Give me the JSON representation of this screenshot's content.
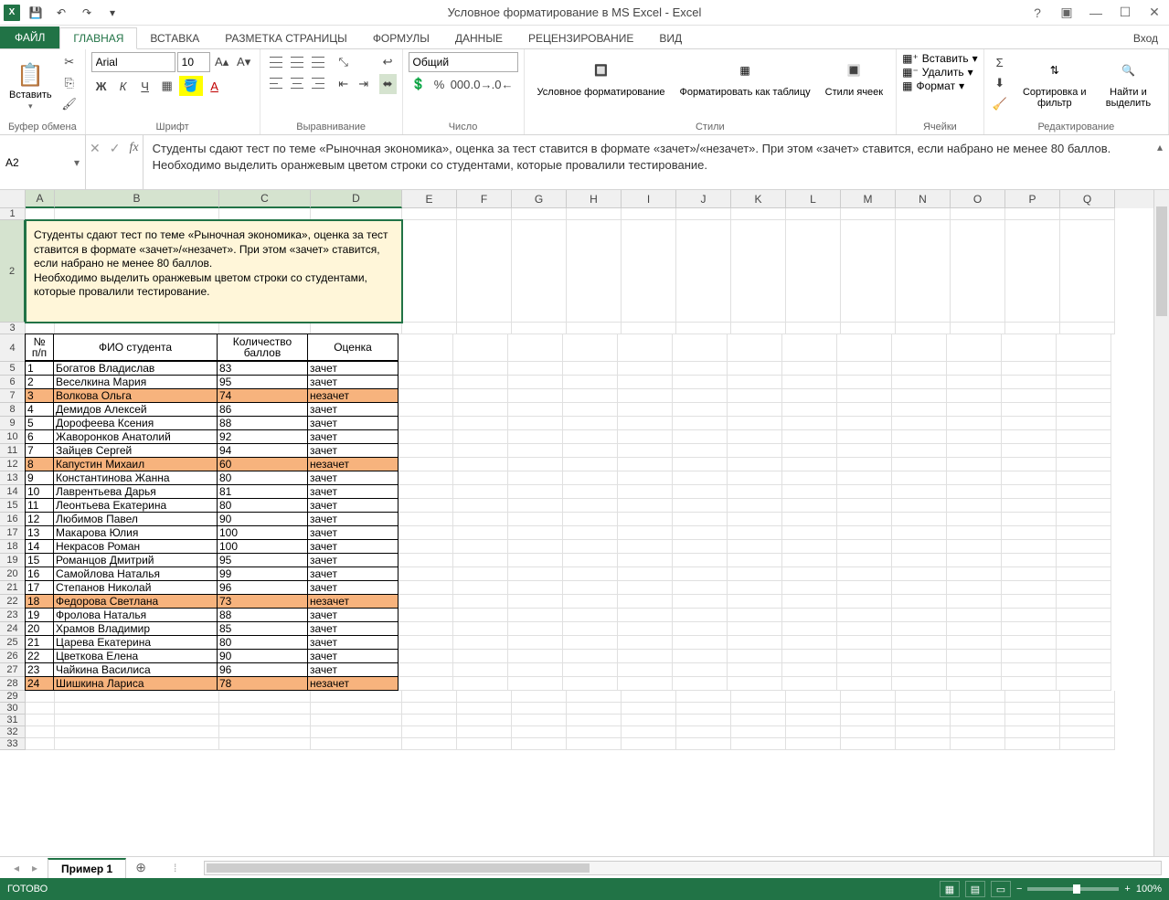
{
  "title": "Условное форматирование в MS Excel - Excel",
  "signin": "Вход",
  "tabs": [
    "ФАЙЛ",
    "ГЛАВНАЯ",
    "ВСТАВКА",
    "РАЗМЕТКА СТРАНИЦЫ",
    "ФОРМУЛЫ",
    "ДАННЫЕ",
    "РЕЦЕНЗИРОВАНИЕ",
    "ВИД"
  ],
  "ribbon": {
    "clipboard": {
      "label": "Буфер обмена",
      "paste": "Вставить"
    },
    "font": {
      "label": "Шрифт",
      "name": "Arial",
      "size": "10"
    },
    "alignment": {
      "label": "Выравнивание"
    },
    "number": {
      "label": "Число",
      "format": "Общий"
    },
    "styles": {
      "label": "Стили",
      "cond": "Условное форматирование",
      "table": "Форматировать как таблицу",
      "cell": "Стили ячеек"
    },
    "cells": {
      "label": "Ячейки",
      "insert": "Вставить",
      "delete": "Удалить",
      "format": "Формат"
    },
    "editing": {
      "label": "Редактирование",
      "sort": "Сортировка и фильтр",
      "find": "Найти и выделить"
    }
  },
  "namebox": "A2",
  "formula_line1": "Студенты сдают тест по теме «Рыночная экономика», оценка за тест ставится в формате «зачет»/«незачет». При этом «зачет» ставится, если набрано не менее 80 баллов.",
  "formula_line2": "Необходимо выделить оранжевым цветом строки со студентами, которые провалили тестирование.",
  "yellow_text": "Студенты сдают тест по теме «Рыночная экономика», оценка за тест ставится в формате «зачет»/«незачет». При этом «зачет» ставится, если набрано не менее 80 баллов.\nНеобходимо выделить оранжевым цветом строки со студентами, которые провалили тестирование.",
  "col_headers": [
    "A",
    "B",
    "C",
    "D",
    "E",
    "F",
    "G",
    "H",
    "I",
    "J",
    "K",
    "L",
    "M",
    "N",
    "O",
    "P",
    "Q"
  ],
  "table_headers": {
    "num": "№ п/п",
    "fio": "ФИО студента",
    "score": "Количество баллов",
    "grade": "Оценка"
  },
  "rows": [
    {
      "n": "1",
      "fio": "Богатов Владислав",
      "s": "83",
      "g": "зачет",
      "hl": false
    },
    {
      "n": "2",
      "fio": "Веселкина Мария",
      "s": "95",
      "g": "зачет",
      "hl": false
    },
    {
      "n": "3",
      "fio": "Волкова Ольга",
      "s": "74",
      "g": "незачет",
      "hl": true
    },
    {
      "n": "4",
      "fio": "Демидов Алексей",
      "s": "86",
      "g": "зачет",
      "hl": false
    },
    {
      "n": "5",
      "fio": "Дорофеева Ксения",
      "s": "88",
      "g": "зачет",
      "hl": false
    },
    {
      "n": "6",
      "fio": "Жаворонков Анатолий",
      "s": "92",
      "g": "зачет",
      "hl": false
    },
    {
      "n": "7",
      "fio": "Зайцев Сергей",
      "s": "94",
      "g": "зачет",
      "hl": false
    },
    {
      "n": "8",
      "fio": "Капустин Михаил",
      "s": "60",
      "g": "незачет",
      "hl": true
    },
    {
      "n": "9",
      "fio": "Константинова Жанна",
      "s": "80",
      "g": "зачет",
      "hl": false
    },
    {
      "n": "10",
      "fio": "Лаврентьева Дарья",
      "s": "81",
      "g": "зачет",
      "hl": false
    },
    {
      "n": "11",
      "fio": "Леонтьева Екатерина",
      "s": "80",
      "g": "зачет",
      "hl": false
    },
    {
      "n": "12",
      "fio": "Любимов Павел",
      "s": "90",
      "g": "зачет",
      "hl": false
    },
    {
      "n": "13",
      "fio": "Макарова Юлия",
      "s": "100",
      "g": "зачет",
      "hl": false
    },
    {
      "n": "14",
      "fio": "Некрасов Роман",
      "s": "100",
      "g": "зачет",
      "hl": false
    },
    {
      "n": "15",
      "fio": "Романцов Дмитрий",
      "s": "95",
      "g": "зачет",
      "hl": false
    },
    {
      "n": "16",
      "fio": "Самойлова Наталья",
      "s": "99",
      "g": "зачет",
      "hl": false
    },
    {
      "n": "17",
      "fio": "Степанов Николай",
      "s": "96",
      "g": "зачет",
      "hl": false
    },
    {
      "n": "18",
      "fio": "Федорова Светлана",
      "s": "73",
      "g": "незачет",
      "hl": true
    },
    {
      "n": "19",
      "fio": "Фролова Наталья",
      "s": "88",
      "g": "зачет",
      "hl": false
    },
    {
      "n": "20",
      "fio": "Храмов Владимир",
      "s": "85",
      "g": "зачет",
      "hl": false
    },
    {
      "n": "21",
      "fio": "Царева Екатерина",
      "s": "80",
      "g": "зачет",
      "hl": false
    },
    {
      "n": "22",
      "fio": "Цветкова Елена",
      "s": "90",
      "g": "зачет",
      "hl": false
    },
    {
      "n": "23",
      "fio": "Чайкина Василиса",
      "s": "96",
      "g": "зачет",
      "hl": false
    },
    {
      "n": "24",
      "fio": "Шишкина Лариса",
      "s": "78",
      "g": "незачет",
      "hl": true
    }
  ],
  "sheet_tab": "Пример 1",
  "status": "ГОТОВО",
  "zoom": "100%"
}
